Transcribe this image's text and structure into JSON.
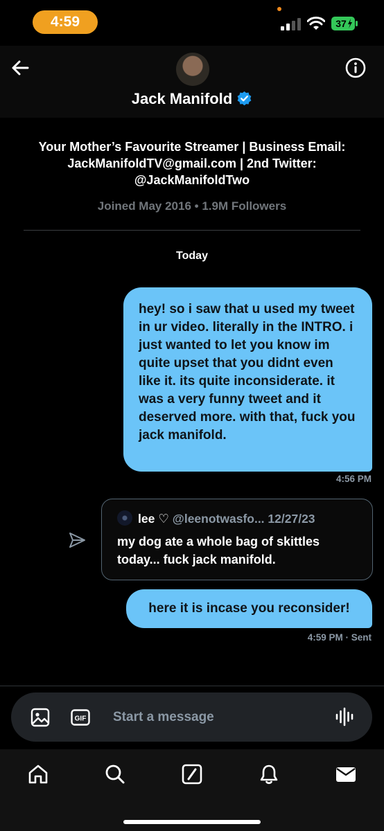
{
  "status_bar": {
    "time": "4:59",
    "battery": "37",
    "colors": {
      "time_pill": "#f0a020",
      "battery": "#34c759"
    }
  },
  "header": {
    "back_icon": "arrow-left-icon",
    "info_icon": "info-circle-icon",
    "name": "Jack Manifold",
    "verified_icon": "verified-badge-icon"
  },
  "profile": {
    "bio": "Your Mother’s Favourite Streamer | Business Email: JackManifoldTV@gmail.com | 2nd Twitter: @JackManifoldTwo",
    "meta": "Joined May 2016 • 1.9M Followers"
  },
  "conversation": {
    "date_separator": "Today",
    "messages": [
      {
        "text": "hey! so i saw that u used my tweet in ur video. literally in the INTRO. i just wanted to let you know im quite upset that you didnt even like it. its quite inconsiderate. it was a very funny tweet and it deserved more. with that, fuck you jack manifold.",
        "timestamp": "4:56 PM"
      },
      {
        "type": "shared_tweet",
        "author_name": "lee ♡",
        "author_handle": "@leenotwasfo...",
        "date": "12/27/23",
        "text": "my dog ate a whole bag of skittles today... fuck jack manifold."
      },
      {
        "text": "here it is incase you reconsider!",
        "timestamp": "4:59 PM · Sent"
      }
    ],
    "bubble_color": "#6bc4f8"
  },
  "composer": {
    "placeholder": "Start a message",
    "gif_label": "GIF"
  },
  "tabbar": {
    "items": [
      "home-icon",
      "search-icon",
      "compose-icon",
      "notifications-icon",
      "messages-icon"
    ]
  }
}
